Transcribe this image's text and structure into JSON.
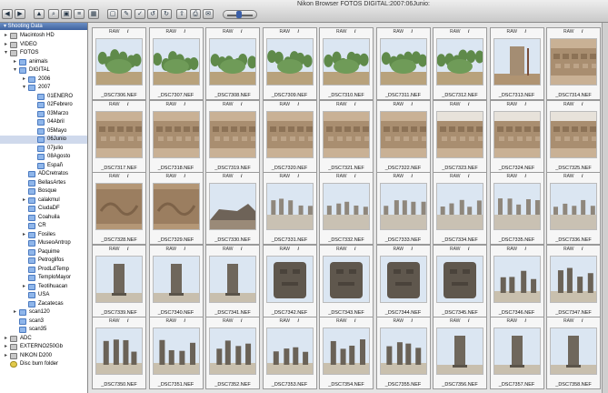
{
  "window": {
    "title": "Nikon Browser FOTOS DIGITAL:2007:06Junio:"
  },
  "toolbar": {
    "buttons": [
      "back",
      "forward",
      "up",
      "zoom",
      "browse",
      "list",
      "grid",
      "preview",
      "edit",
      "check",
      "rotate-left",
      "rotate-right",
      "export",
      "print",
      "mail"
    ]
  },
  "sidebar": {
    "header": "▾ Shooting Data",
    "items": [
      {
        "label": "Macintosh HD",
        "level": 0,
        "disc": "▸",
        "icon": "drive"
      },
      {
        "label": "VIDEO",
        "level": 0,
        "disc": "▸",
        "icon": "drive"
      },
      {
        "label": "FOTOS",
        "level": 0,
        "disc": "▾",
        "icon": "drive"
      },
      {
        "label": "animals",
        "level": 1,
        "disc": "▸",
        "icon": "folder"
      },
      {
        "label": "DIGITAL",
        "level": 1,
        "disc": "▾",
        "icon": "folder"
      },
      {
        "label": "2006",
        "level": 2,
        "disc": "▸",
        "icon": "folder"
      },
      {
        "label": "2007",
        "level": 2,
        "disc": "▾",
        "icon": "folder"
      },
      {
        "label": "01ENERO",
        "level": 3,
        "disc": "",
        "icon": "folder"
      },
      {
        "label": "02Febrero",
        "level": 3,
        "disc": "",
        "icon": "folder"
      },
      {
        "label": "03Marzo",
        "level": 3,
        "disc": "",
        "icon": "folder"
      },
      {
        "label": "04Abril",
        "level": 3,
        "disc": "",
        "icon": "folder"
      },
      {
        "label": "05Mayo",
        "level": 3,
        "disc": "",
        "icon": "folder"
      },
      {
        "label": "06Junio",
        "level": 3,
        "disc": "",
        "icon": "folder",
        "selected": true
      },
      {
        "label": "07julio",
        "level": 3,
        "disc": "",
        "icon": "folder"
      },
      {
        "label": "08Agosto",
        "level": 3,
        "disc": "",
        "icon": "folder"
      },
      {
        "label": "Españ",
        "level": 3,
        "disc": "",
        "icon": "folder"
      },
      {
        "label": "ADCretratos",
        "level": 2,
        "disc": "",
        "icon": "folder"
      },
      {
        "label": "BellasArtes",
        "level": 2,
        "disc": "",
        "icon": "folder"
      },
      {
        "label": "Bosque",
        "level": 2,
        "disc": "",
        "icon": "folder"
      },
      {
        "label": "calakmul",
        "level": 2,
        "disc": "▸",
        "icon": "folder"
      },
      {
        "label": "CiudaDF",
        "level": 2,
        "disc": "",
        "icon": "folder"
      },
      {
        "label": "Coahuila",
        "level": 2,
        "disc": "",
        "icon": "folder"
      },
      {
        "label": "CR",
        "level": 2,
        "disc": "",
        "icon": "folder"
      },
      {
        "label": "Fosiles",
        "level": 2,
        "disc": "▸",
        "icon": "folder"
      },
      {
        "label": "MuseoAntrop",
        "level": 2,
        "disc": "",
        "icon": "folder"
      },
      {
        "label": "Paquime",
        "level": 2,
        "disc": "",
        "icon": "folder"
      },
      {
        "label": "Petroglifos",
        "level": 2,
        "disc": "",
        "icon": "folder"
      },
      {
        "label": "ProdLdTemp",
        "level": 2,
        "disc": "",
        "icon": "folder"
      },
      {
        "label": "TemploMayor",
        "level": 2,
        "disc": "",
        "icon": "folder"
      },
      {
        "label": "Teotihuacan",
        "level": 2,
        "disc": "▸",
        "icon": "folder"
      },
      {
        "label": "USA",
        "level": 2,
        "disc": "",
        "icon": "folder"
      },
      {
        "label": "Zacatecas",
        "level": 2,
        "disc": "",
        "icon": "folder"
      },
      {
        "label": "scan120",
        "level": 1,
        "disc": "▸",
        "icon": "folder"
      },
      {
        "label": "scan3",
        "level": 1,
        "disc": "",
        "icon": "folder"
      },
      {
        "label": "scan35",
        "level": 1,
        "disc": "",
        "icon": "folder"
      },
      {
        "label": "ADC",
        "level": 0,
        "disc": "▸",
        "icon": "drive"
      },
      {
        "label": "EXTERNO250Gb",
        "level": 0,
        "disc": "▸",
        "icon": "drive"
      },
      {
        "label": "NIKON D200",
        "level": 0,
        "disc": "▸",
        "icon": "drive"
      },
      {
        "label": "Disc burn folder",
        "level": 0,
        "disc": "",
        "icon": "burn"
      }
    ]
  },
  "grid": {
    "raw_label": "RAW",
    "info_label": "i",
    "items": [
      {
        "name": "_DSC7306.NEF",
        "type": "cactus"
      },
      {
        "name": "_DSC7307.NEF",
        "type": "cactus"
      },
      {
        "name": "_DSC7308.NEF",
        "type": "cactus"
      },
      {
        "name": "_DSC7309.NEF",
        "type": "cactus"
      },
      {
        "name": "_DSC7310.NEF",
        "type": "cactus"
      },
      {
        "name": "_DSC7311.NEF",
        "type": "cactus"
      },
      {
        "name": "_DSC7312.NEF",
        "type": "cactus"
      },
      {
        "name": "_DSC7313.NEF",
        "type": "stela"
      },
      {
        "name": "_DSC7314.NEF",
        "type": "frieze"
      },
      {
        "name": "_DSC7317.NEF",
        "type": "frieze"
      },
      {
        "name": "_DSC7318.NEF",
        "type": "frieze"
      },
      {
        "name": "_DSC7319.NEF",
        "type": "frieze"
      },
      {
        "name": "_DSC7320.NEF",
        "type": "frieze"
      },
      {
        "name": "_DSC7321.NEF",
        "type": "frieze"
      },
      {
        "name": "_DSC7322.NEF",
        "type": "frieze"
      },
      {
        "name": "_DSC7323.NEF",
        "type": "wall"
      },
      {
        "name": "_DSC7324.NEF",
        "type": "wall"
      },
      {
        "name": "_DSC7325.NEF",
        "type": "wall"
      },
      {
        "name": "_DSC7328.NEF",
        "type": "relief"
      },
      {
        "name": "_DSC7329.NEF",
        "type": "relief"
      },
      {
        "name": "_DSC7330.NEF",
        "type": "ruins"
      },
      {
        "name": "_DSC7331.NEF",
        "type": "columns"
      },
      {
        "name": "_DSC7332.NEF",
        "type": "columns"
      },
      {
        "name": "_DSC7333.NEF",
        "type": "columns"
      },
      {
        "name": "_DSC7334.NEF",
        "type": "columns"
      },
      {
        "name": "_DSC7335.NEF",
        "type": "columns"
      },
      {
        "name": "_DSC7336.NEF",
        "type": "columns"
      },
      {
        "name": "_DSC7339.NEF",
        "type": "statue"
      },
      {
        "name": "_DSC7340.NEF",
        "type": "statue"
      },
      {
        "name": "_DSC7341.NEF",
        "type": "statue"
      },
      {
        "name": "_DSC7342.NEF",
        "type": "closeup"
      },
      {
        "name": "_DSC7343.NEF",
        "type": "closeup"
      },
      {
        "name": "_DSC7344.NEF",
        "type": "closeup"
      },
      {
        "name": "_DSC7345.NEF",
        "type": "closeup"
      },
      {
        "name": "_DSC7346.NEF",
        "type": "statues"
      },
      {
        "name": "_DSC7347.NEF",
        "type": "statues"
      },
      {
        "name": "_DSC7350.NEF",
        "type": "statues"
      },
      {
        "name": "_DSC7351.NEF",
        "type": "statues"
      },
      {
        "name": "_DSC7352.NEF",
        "type": "statues"
      },
      {
        "name": "_DSC7353.NEF",
        "type": "statues"
      },
      {
        "name": "_DSC7354.NEF",
        "type": "statues"
      },
      {
        "name": "_DSC7355.NEF",
        "type": "statues"
      },
      {
        "name": "_DSC7356.NEF",
        "type": "statue"
      },
      {
        "name": "_DSC7357.NEF",
        "type": "statue"
      },
      {
        "name": "_DSC7358.NEF",
        "type": "statue"
      }
    ]
  }
}
